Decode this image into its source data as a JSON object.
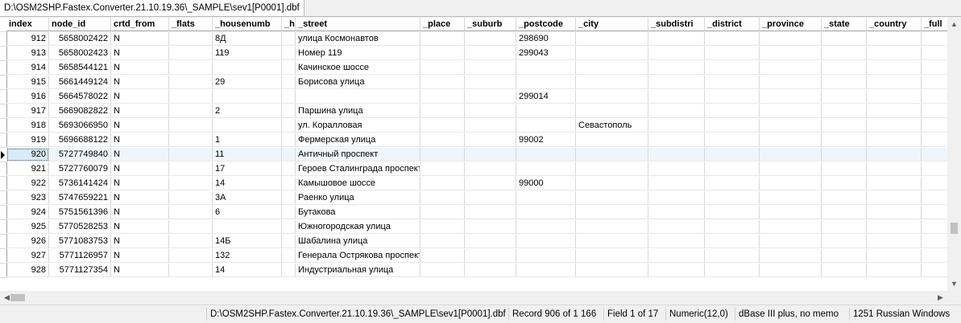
{
  "tab": {
    "title": "D:\\OSM2SHP.Fastex.Converter.21.10.19.36\\_SAMPLE\\sev1[P0001].dbf"
  },
  "columns": [
    "index",
    "node_id",
    "crtd_from",
    "_flats",
    "_housenumb",
    "_h",
    "_street",
    "_place",
    "_suburb",
    "_postcode",
    "_city",
    "_subdistri",
    "_district",
    "_province",
    "_state",
    "_country",
    "_full"
  ],
  "rows": [
    [
      "912",
      "5658002422",
      "N",
      "",
      "8Д",
      "",
      "улица Космонавтов",
      "",
      "",
      "298690",
      "",
      "",
      "",
      "",
      "",
      "",
      ""
    ],
    [
      "913",
      "5658002423",
      "N",
      "",
      "119",
      "",
      "Номер 119",
      "",
      "",
      "299043",
      "",
      "",
      "",
      "",
      "",
      "",
      ""
    ],
    [
      "914",
      "5658544121",
      "N",
      "",
      "",
      "",
      "Качинское шоссе",
      "",
      "",
      "",
      "",
      "",
      "",
      "",
      "",
      "",
      ""
    ],
    [
      "915",
      "5661449124",
      "N",
      "",
      "29",
      "",
      "Борисова улица",
      "",
      "",
      "",
      "",
      "",
      "",
      "",
      "",
      "",
      ""
    ],
    [
      "916",
      "5664578022",
      "N",
      "",
      "",
      "",
      "",
      "",
      "",
      "299014",
      "",
      "",
      "",
      "",
      "",
      "",
      ""
    ],
    [
      "917",
      "5669082822",
      "N",
      "",
      "2",
      "",
      "Паршина улица",
      "",
      "",
      "",
      "",
      "",
      "",
      "",
      "",
      "",
      ""
    ],
    [
      "918",
      "5693066950",
      "N",
      "",
      "",
      "",
      "ул. Коралловая",
      "",
      "",
      "",
      "Севастополь",
      "",
      "",
      "",
      "",
      "",
      ""
    ],
    [
      "919",
      "5696688122",
      "N",
      "",
      "1",
      "",
      "Фермерская улица",
      "",
      "",
      "99002",
      "",
      "",
      "",
      "",
      "",
      "",
      ""
    ],
    [
      "920",
      "5727749840",
      "N",
      "",
      "11",
      "",
      "Античный проспект",
      "",
      "",
      "",
      "",
      "",
      "",
      "",
      "",
      "",
      ""
    ],
    [
      "921",
      "5727760079",
      "N",
      "",
      "17",
      "",
      "Героев Сталинграда проспект",
      "",
      "",
      "",
      "",
      "",
      "",
      "",
      "",
      "",
      ""
    ],
    [
      "922",
      "5736141424",
      "N",
      "",
      "14",
      "",
      "Камышовое шоссе",
      "",
      "",
      "99000",
      "",
      "",
      "",
      "",
      "",
      "",
      ""
    ],
    [
      "923",
      "5747659221",
      "N",
      "",
      "3А",
      "",
      "Раенко улица",
      "",
      "",
      "",
      "",
      "",
      "",
      "",
      "",
      "",
      ""
    ],
    [
      "924",
      "5751561396",
      "N",
      "",
      "6",
      "",
      "Бутакова",
      "",
      "",
      "",
      "",
      "",
      "",
      "",
      "",
      "",
      ""
    ],
    [
      "925",
      "5770528253",
      "N",
      "",
      "",
      "",
      "Южногородская улица",
      "",
      "",
      "",
      "",
      "",
      "",
      "",
      "",
      "",
      ""
    ],
    [
      "926",
      "5771083753",
      "N",
      "",
      "14Б",
      "",
      "Шабалина улица",
      "",
      "",
      "",
      "",
      "",
      "",
      "",
      "",
      "",
      ""
    ],
    [
      "927",
      "5771126957",
      "N",
      "",
      "132",
      "",
      "Генерала Острякова проспект",
      "",
      "",
      "",
      "",
      "",
      "",
      "",
      "",
      "",
      ""
    ],
    [
      "928",
      "5771127354",
      "N",
      "",
      "14",
      "",
      "Индустриальная улица",
      "",
      "",
      "",
      "",
      "",
      "",
      "",
      "",
      "",
      ""
    ]
  ],
  "selected_row_index": 8,
  "status": {
    "path": "D:\\OSM2SHP.Fastex.Converter.21.10.19.36\\_SAMPLE\\sev1[P0001].dbf",
    "record": "Record 906 of 1 166",
    "field": "Field 1 of 17",
    "type": "Numeric(12,0)",
    "format": "dBase III plus, no memo",
    "codepage": "1251 Russian Windows"
  },
  "icons": {
    "row_pointer": "triangle-right-icon",
    "scroll_up": "arrow-up-icon",
    "scroll_down": "arrow-down-icon",
    "scroll_left": "arrow-left-icon",
    "scroll_right": "arrow-right-icon"
  }
}
